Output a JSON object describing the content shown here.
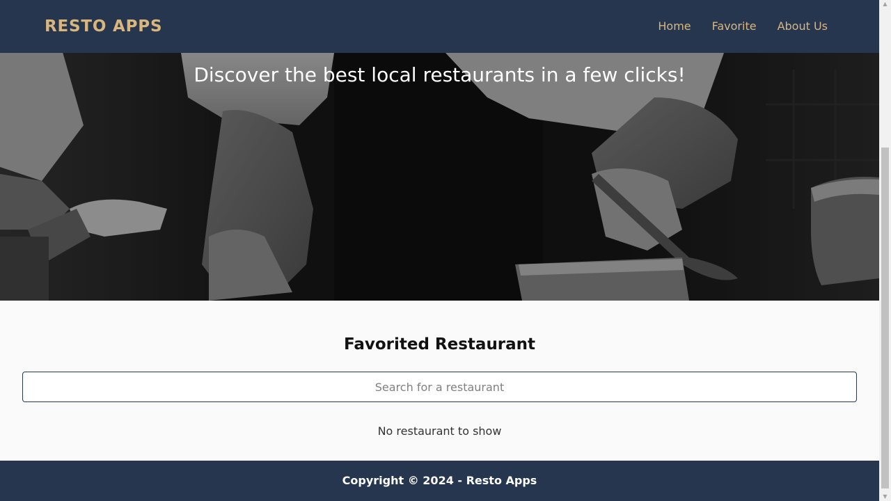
{
  "navbar": {
    "brand": "RESTO APPS",
    "links": [
      "Home",
      "Favorite",
      "About Us"
    ],
    "background": "#26364f",
    "accent": "#d9b67d"
  },
  "hero": {
    "subtitle": "Discover the best local restaurants in a few clicks!"
  },
  "favorites": {
    "title": "Favorited Restaurant",
    "search_placeholder": "Search for a restaurant",
    "empty_message": "No restaurant to show"
  },
  "footer": {
    "text": "Copyright © 2024 - Resto Apps"
  }
}
